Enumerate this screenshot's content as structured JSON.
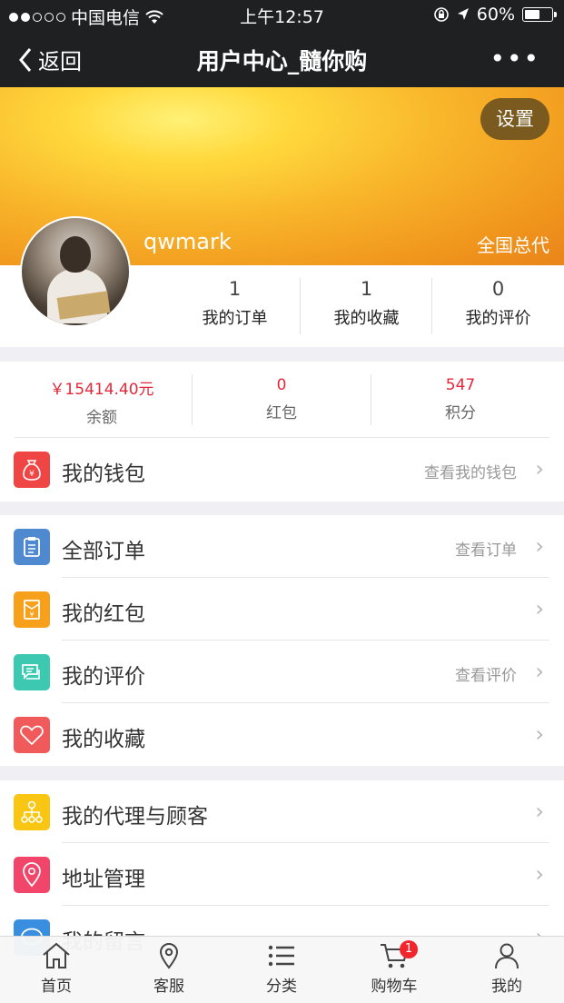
{
  "status_bar": {
    "carrier": "中国电信",
    "time": "上午12:57",
    "battery": "60%",
    "battery_level": 0.6
  },
  "nav": {
    "back_label": "返回",
    "title": "用户中心_髓你购",
    "more": "•••"
  },
  "profile": {
    "settings_label": "设置",
    "username": "qwmark",
    "level": "全国总代"
  },
  "stats": [
    {
      "value": "1",
      "label": "我的订单"
    },
    {
      "value": "1",
      "label": "我的收藏"
    },
    {
      "value": "0",
      "label": "我的评价"
    }
  ],
  "wallet": {
    "balance_value": "￥15414.40元",
    "balance_label": "余额",
    "redpacket_value": "0",
    "redpacket_label": "红包",
    "points_value": "547",
    "points_label": "积分",
    "row_label": "我的钱包",
    "row_hint": "查看我的钱包"
  },
  "menu": {
    "orders": {
      "label": "全部订单",
      "hint": "查看订单"
    },
    "redpackets": {
      "label": "我的红包"
    },
    "reviews": {
      "label": "我的评价",
      "hint": "查看评价"
    },
    "favorites": {
      "label": "我的收藏"
    },
    "agents": {
      "label": "我的代理与顾客"
    },
    "address": {
      "label": "地址管理"
    },
    "messages": {
      "label": "我的留言"
    }
  },
  "colors": {
    "wallet_icon": "#f04545",
    "orders_icon": "#4f8ad1",
    "redpacket_icon": "#f7a01b",
    "review_icon": "#3dc8b1",
    "favorite_icon": "#f05a5a",
    "agents_icon": "#f8c613",
    "address_icon": "#f2456a",
    "messages_icon": "#3a8ee0",
    "accent_red": "#e4283a"
  },
  "tabbar": {
    "home": "首页",
    "service": "客服",
    "category": "分类",
    "cart": "购物车",
    "cart_badge": "1",
    "mine": "我的"
  }
}
